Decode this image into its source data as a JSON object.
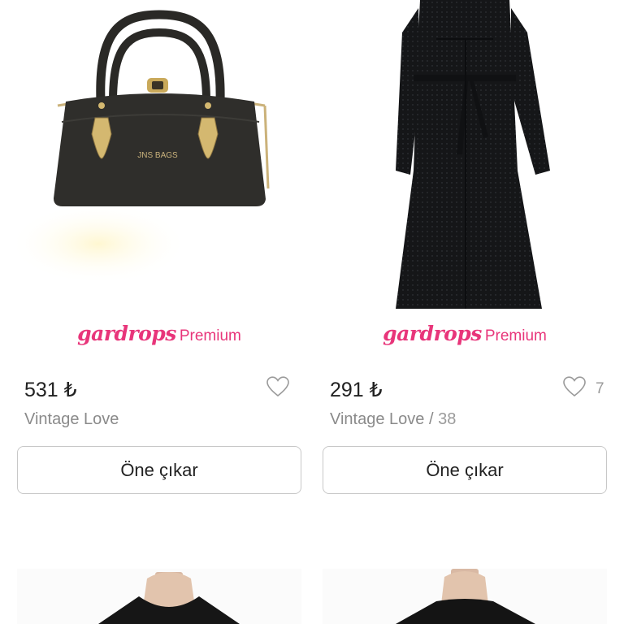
{
  "products": [
    {
      "price": "531 ₺",
      "title": "Vintage Love",
      "size_separator": "",
      "size": "",
      "likes": "",
      "brand_logo": "gardrops",
      "brand_tier": "Premium",
      "bag_label": "JNS BAGS",
      "promote_label": "Öne çıkar"
    },
    {
      "price": "291 ₺",
      "title": "Vintage Love",
      "size_separator": " / ",
      "size": "38",
      "likes": "7",
      "brand_logo": "gardrops",
      "brand_tier": "Premium",
      "promote_label": "Öne çıkar"
    }
  ],
  "colors": {
    "brand": "#e8357a",
    "border": "#c8c8c8",
    "muted": "#8a8a8a"
  },
  "icons": {
    "like": "heart-outline-icon"
  }
}
